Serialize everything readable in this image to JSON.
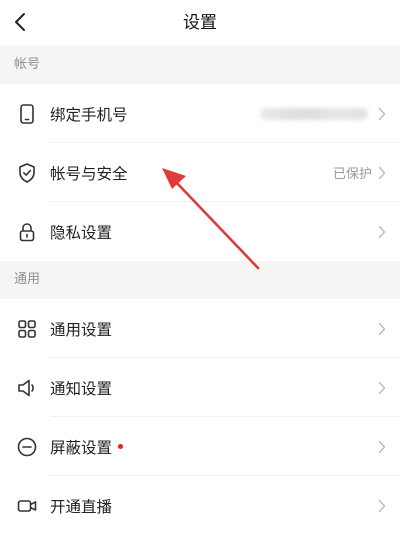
{
  "nav": {
    "title": "设置"
  },
  "sections": {
    "account": "帐号",
    "general": "通用"
  },
  "rows": {
    "bind_phone": {
      "label": "绑定手机号",
      "value": ""
    },
    "account_security": {
      "label": "帐号与安全",
      "value": "已保护"
    },
    "privacy": {
      "label": "隐私设置"
    },
    "general_settings": {
      "label": "通用设置"
    },
    "notification": {
      "label": "通知设置"
    },
    "block": {
      "label": "屏蔽设置"
    },
    "live": {
      "label": "开通直播"
    }
  },
  "colors": {
    "annotation_arrow": "#e03a3a",
    "badge_dot": "#e1251b",
    "section_bg": "#f5f5f5"
  },
  "icons": {
    "back": "chevron-left-icon",
    "bind_phone": "phone-icon",
    "account_security": "shield-check-icon",
    "privacy": "lock-icon",
    "general_settings": "grid-icon",
    "notification": "speaker-icon",
    "block": "minus-circle-icon",
    "live": "video-camera-icon"
  }
}
